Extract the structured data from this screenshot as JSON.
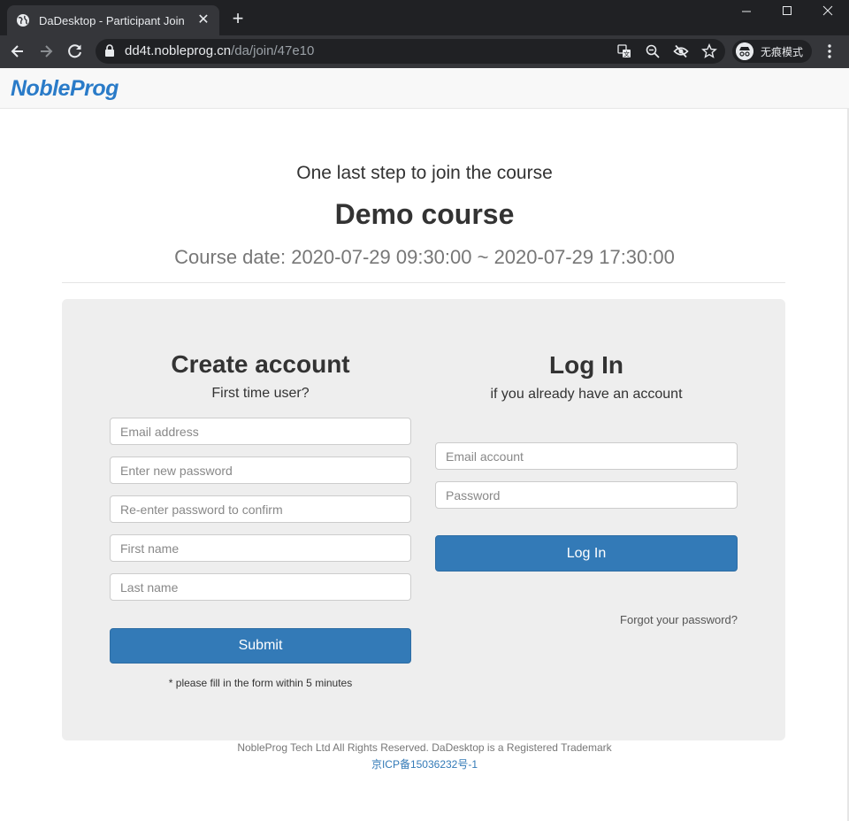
{
  "browser": {
    "tab_title": "DaDesktop - Participant Join",
    "tab_close": "✕",
    "new_tab": "+",
    "url_host": "dd4t.nobleprog.cn",
    "url_path": "/da/join/47e10",
    "incognito_label": "无痕模式",
    "icons": [
      "globe-icon",
      "back-icon",
      "forward-icon",
      "reload-icon",
      "lock-icon",
      "translate-icon",
      "zoom-icon",
      "eye-off-icon",
      "star-icon",
      "incognito-icon",
      "menu-icon",
      "minimize-icon",
      "maximize-icon",
      "close-window-icon"
    ]
  },
  "header": {
    "logo": "NobleProg"
  },
  "hero": {
    "step_text": "One last step to join the course",
    "course_title": "Demo course",
    "course_date": "Course date: 2020-07-29 09:30:00 ~ 2020-07-29 17:30:00"
  },
  "create_account": {
    "title": "Create account",
    "subtitle": "First time user?",
    "email_placeholder": "Email address",
    "password_placeholder": "Enter new password",
    "confirm_placeholder": "Re-enter password to confirm",
    "first_name_placeholder": "First name",
    "last_name_placeholder": "Last name",
    "submit_label": "Submit",
    "note": "* please fill in the form within 5 minutes"
  },
  "login": {
    "title": "Log In",
    "subtitle": "if you already have an account",
    "email_placeholder": "Email account",
    "password_placeholder": "Password",
    "login_label": "Log In",
    "forgot_label": "Forgot your password?"
  },
  "footer": {
    "copyright": "NobleProg Tech Ltd All Rights Reserved. DaDesktop is a Registered Trademark",
    "icp": "京ICP备15036232号-1"
  },
  "colors": {
    "brand_blue": "#337ab7",
    "logo_blue": "#2a7bc8",
    "panel_bg": "#eeeeee",
    "chrome_dark": "#202124"
  }
}
